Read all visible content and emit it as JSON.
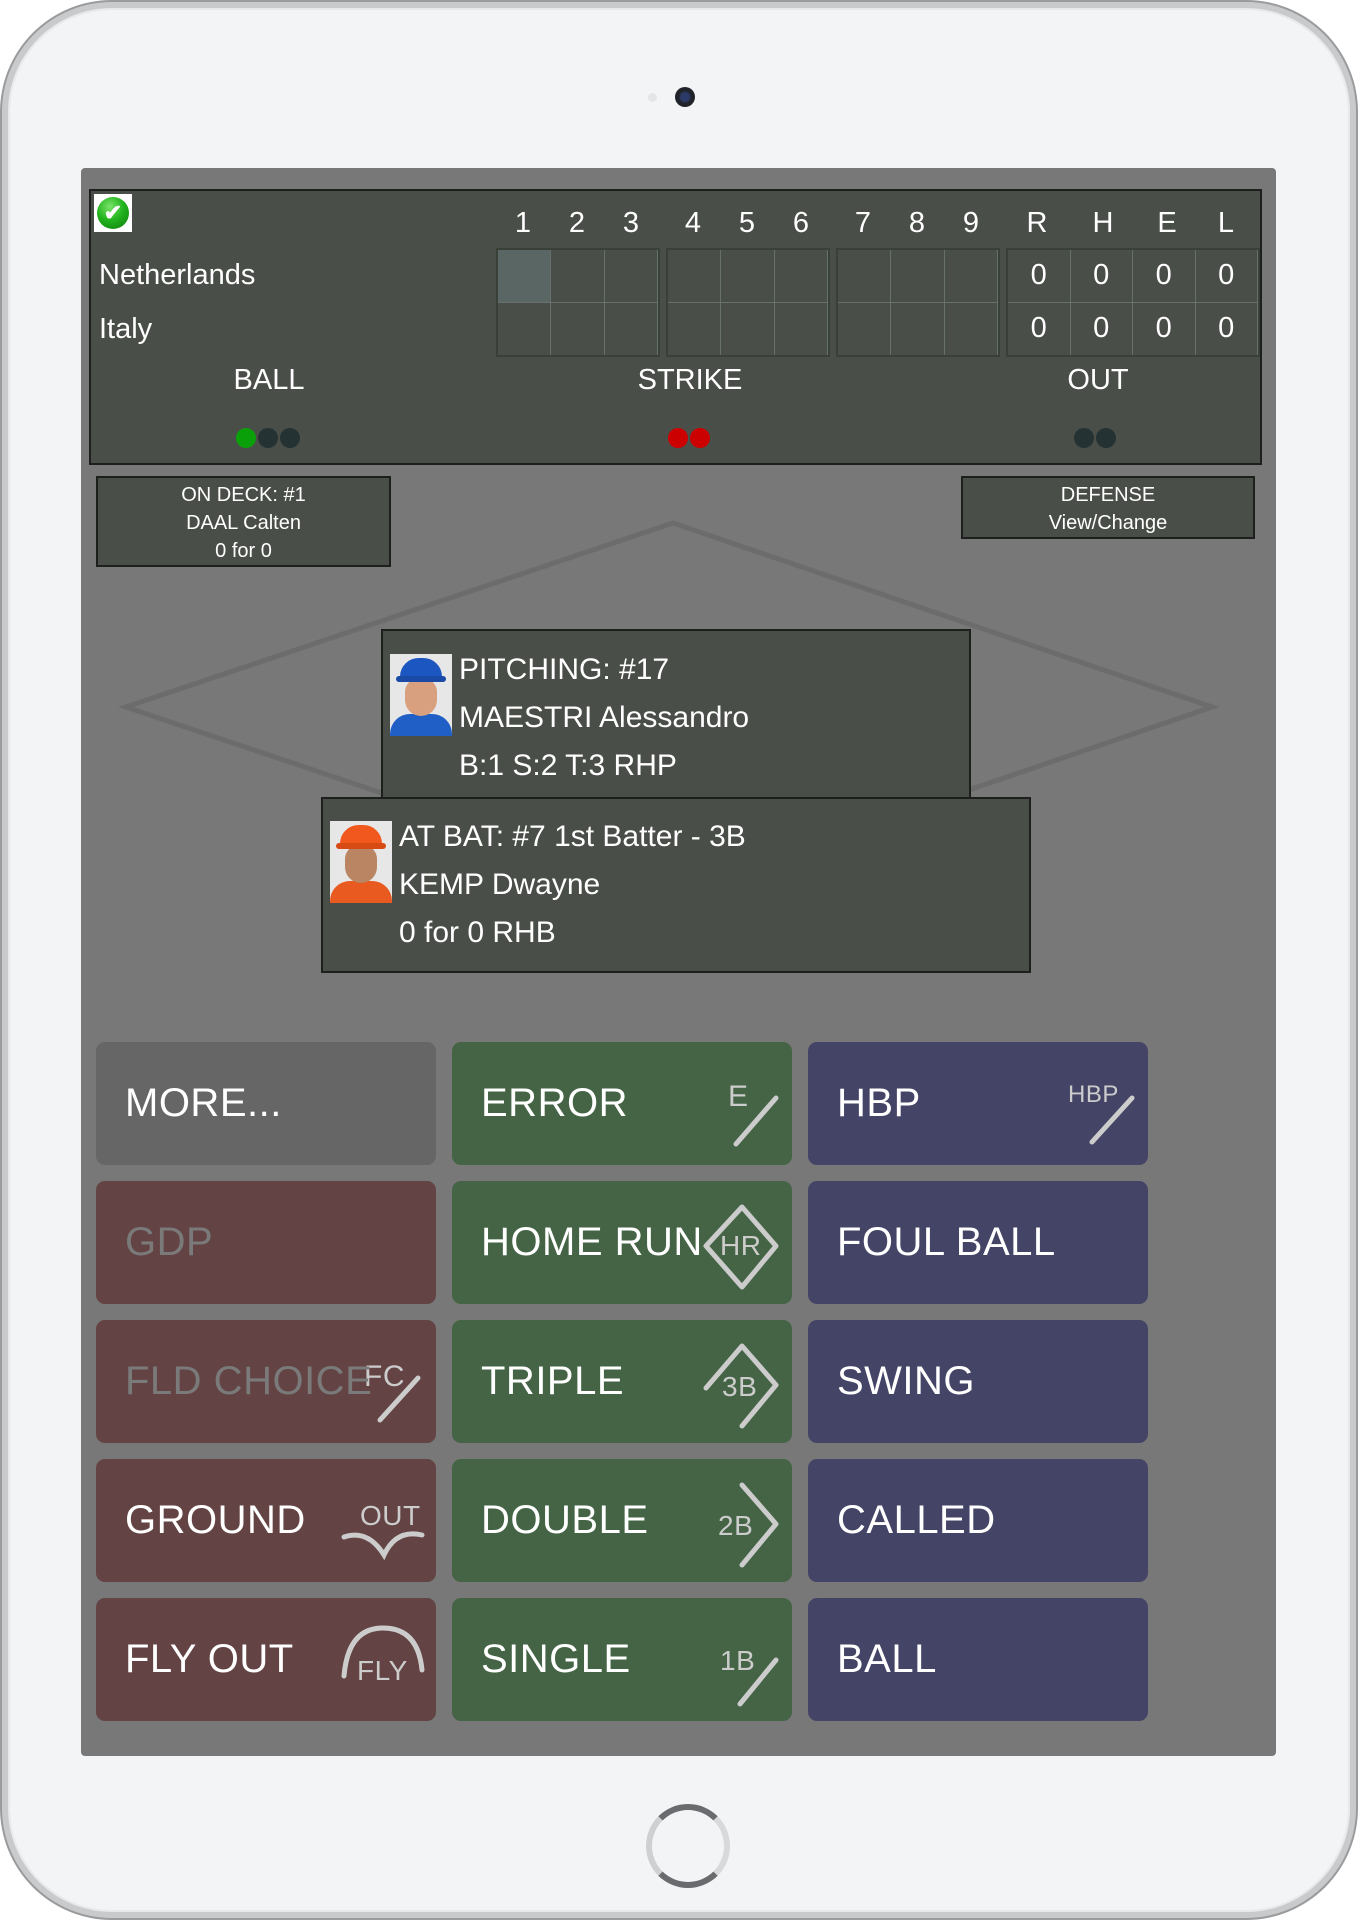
{
  "colors": {
    "screen_bg": "#787878",
    "panel_bg": "#4a4e48",
    "ball_on": "#0aa00a",
    "ball_off": "#243233",
    "strike_on": "#cc0000",
    "out_off": "#243233",
    "button_gray": "#666666",
    "button_red": "#634343",
    "button_green": "#446445",
    "button_blue": "#444466"
  },
  "scoreboard": {
    "status_icon": "green-checkmark-icon",
    "teams": [
      "Netherlands",
      "Italy"
    ],
    "innings": [
      "1",
      "2",
      "3",
      "4",
      "5",
      "6",
      "7",
      "8",
      "9"
    ],
    "totals_headers": [
      "R",
      "H",
      "E",
      "L"
    ],
    "totals": [
      [
        "0",
        "0",
        "0",
        "0"
      ],
      [
        "0",
        "0",
        "0",
        "0"
      ]
    ],
    "inning_scores": [
      [
        "",
        "",
        "",
        "",
        "",
        "",
        "",
        "",
        ""
      ],
      [
        "",
        "",
        "",
        "",
        "",
        "",
        "",
        "",
        ""
      ]
    ],
    "current_inning": {
      "team_index": 0,
      "inning_index": 0
    },
    "count": {
      "ball_label": "BALL",
      "strike_label": "STRIKE",
      "out_label": "OUT",
      "balls": 1,
      "balls_max": 3,
      "strikes": 2,
      "strikes_max": 2,
      "outs": 0,
      "outs_max": 2
    }
  },
  "on_deck": {
    "line1": "ON DECK: #1",
    "line2": "DAAL Calten",
    "line3": "0 for 0"
  },
  "defense": {
    "line1": "DEFENSE",
    "line2": "View/Change"
  },
  "pitching": {
    "line1": "PITCHING: #17",
    "line2": "MAESTRI Alessandro",
    "line3": "B:1 S:2 T:3 RHP",
    "photo": "player-photo-blue-cap"
  },
  "at_bat": {
    "line1": "AT BAT: #7 1st Batter - 3B",
    "line2": "KEMP Dwayne",
    "line3": "0 for 0 RHB",
    "photo": "player-photo-orange-cap"
  },
  "buttons": {
    "more": {
      "label": "MORE..."
    },
    "gdp": {
      "label": "GDP",
      "disabled": true
    },
    "fld_choice": {
      "label": "FLD CHOICE",
      "icon_text": "FC",
      "disabled": true
    },
    "ground": {
      "label": "GROUND",
      "icon_text": "OUT"
    },
    "fly_out": {
      "label": "FLY OUT",
      "icon_text": "FLY"
    },
    "error": {
      "label": "ERROR",
      "icon_text": "E"
    },
    "home_run": {
      "label": "HOME RUN",
      "icon_text": "HR"
    },
    "triple": {
      "label": "TRIPLE",
      "icon_text": "3B"
    },
    "double": {
      "label": "DOUBLE",
      "icon_text": "2B"
    },
    "single": {
      "label": "SINGLE",
      "icon_text": "1B"
    },
    "hbp": {
      "label": "HBP",
      "icon_text": "HBP"
    },
    "foul_ball": {
      "label": "FOUL BALL"
    },
    "swing": {
      "label": "SWING"
    },
    "called": {
      "label": "CALLED"
    },
    "ball": {
      "label": "BALL"
    }
  }
}
